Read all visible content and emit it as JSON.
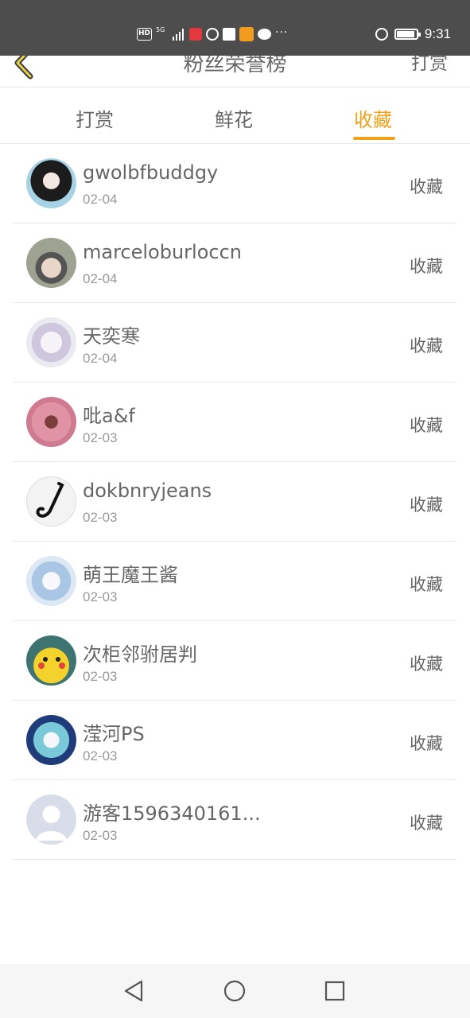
{
  "status_bar": {
    "hd_label": "HD",
    "network_label": "5G",
    "more_icons": "···",
    "time": "9:31",
    "battery_level": 0.9
  },
  "header": {
    "title": "粉丝荣誉榜",
    "action_label": "打赏",
    "back_icon": "chevron-left-icon",
    "accent": "#f0a21b"
  },
  "tabs": [
    {
      "label": "打赏",
      "active": false
    },
    {
      "label": "鲜花",
      "active": false
    },
    {
      "label": "收藏",
      "active": true
    }
  ],
  "list": [
    {
      "name": "gwolbfbuddgy",
      "date": "02-04",
      "action": "收藏"
    },
    {
      "name": "marceloburloccn",
      "date": "02-04",
      "action": "收藏"
    },
    {
      "name": "天奕寒",
      "date": "02-04",
      "action": "收藏"
    },
    {
      "name": "吡a&f",
      "date": "02-03",
      "action": "收藏"
    },
    {
      "name": "dokbnryjeans",
      "date": "02-03",
      "action": "收藏"
    },
    {
      "name": "萌王魔王酱",
      "date": "02-03",
      "action": "收藏"
    },
    {
      "name": "次柜邻驸居判",
      "date": "02-03",
      "action": "收藏"
    },
    {
      "name": "滢河PS",
      "date": "02-03",
      "action": "收藏"
    },
    {
      "name": "游客1596340161...",
      "date": "02-03",
      "action": "收藏"
    }
  ],
  "nav": {
    "back_icon": "triangle-back-icon",
    "home_icon": "circle-home-icon",
    "recents_icon": "square-recents-icon"
  }
}
